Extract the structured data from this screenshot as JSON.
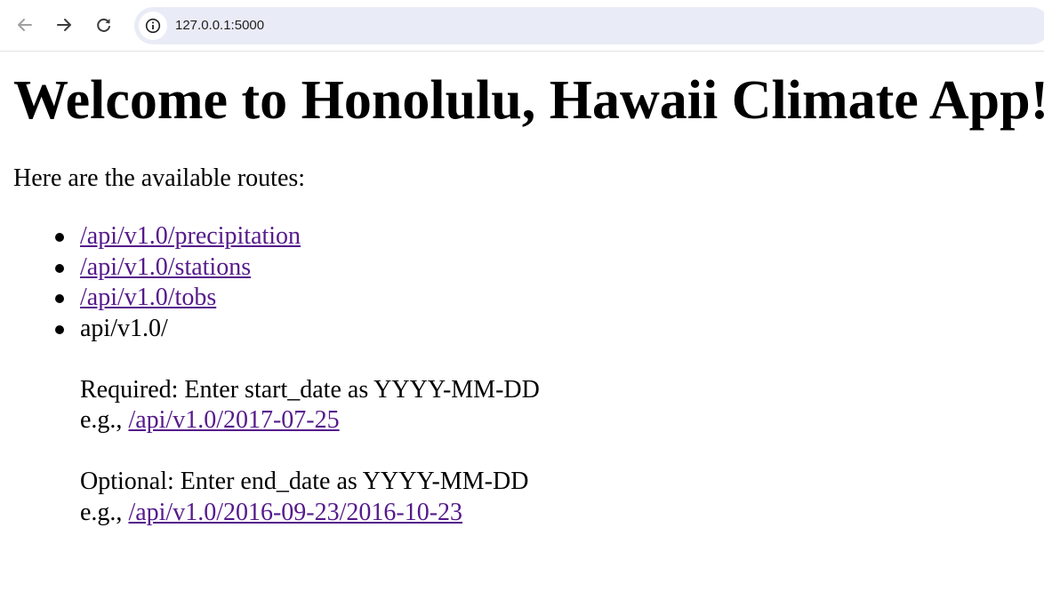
{
  "browser": {
    "url": "127.0.0.1:5000",
    "icons": {
      "back": "arrow-left-icon",
      "forward": "arrow-right-icon",
      "reload": "reload-icon",
      "site_info": "info-circle-icon"
    },
    "colors": {
      "omnibox_bg": "#e9ecf6",
      "icon_disabled": "#a0a0a0",
      "icon_active": "#3c3c3c"
    }
  },
  "page": {
    "title": "Welcome to Honolulu, Hawaii Climate App!",
    "intro": "Here are the available routes:",
    "routes": [
      {
        "label": "/api/v1.0/precipitation"
      },
      {
        "label": "/api/v1.0/stations"
      },
      {
        "label": "/api/v1.0/tobs"
      }
    ],
    "dynamic_route": {
      "label": "api/v1.0/",
      "required_text": "Required: Enter start_date as YYYY-MM-DD",
      "required_example_prefix": "e.g.,",
      "required_example_link": "/api/v1.0/2017-07-25",
      "optional_text": "Optional: Enter end_date as YYYY-MM-DD",
      "optional_example_prefix": "e.g.,",
      "optional_example_link": "/api/v1.0/2016-09-23/2016-10-23"
    },
    "colors": {
      "link": "#551a8b",
      "text": "#000000"
    }
  }
}
